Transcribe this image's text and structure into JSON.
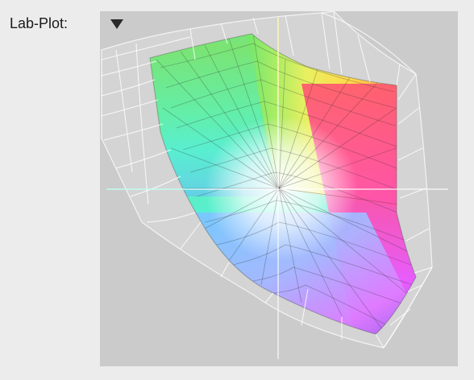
{
  "plot": {
    "label": "Lab-Plot:",
    "menu_icon": "triangle-down-icon",
    "colors": {
      "background": "#cbcbcb",
      "wireframe": "#ffffff",
      "page": "#ececec"
    }
  }
}
